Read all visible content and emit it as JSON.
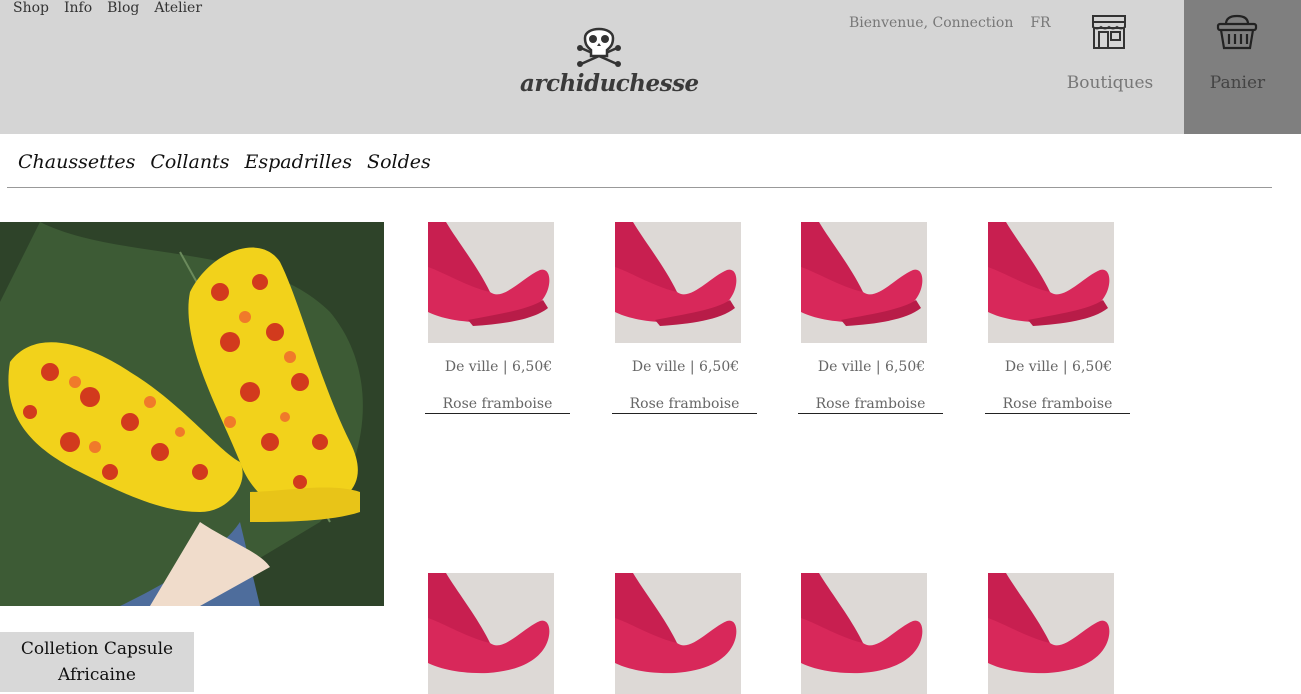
{
  "topnav": {
    "items": [
      "Shop",
      "Info",
      "Blog",
      "Atelier"
    ]
  },
  "logo": {
    "text": "archiduchesse"
  },
  "user": {
    "welcome": "Bienvenue, Connection",
    "lang": "FR"
  },
  "boutiques": {
    "label": "Boutiques"
  },
  "panier": {
    "label": "Panier"
  },
  "categories": [
    "Chaussettes",
    "Collants",
    "Espadrilles",
    "Soldes"
  ],
  "hero": {
    "caption_line1": "Colletion Capsule",
    "caption_line2": "Africaine"
  },
  "products": [
    {
      "price": "De ville | 6,50€",
      "color": "Rose framboise"
    },
    {
      "price": "De ville | 6,50€",
      "color": "Rose framboise"
    },
    {
      "price": "De ville | 6,50€",
      "color": "Rose framboise"
    },
    {
      "price": "De ville | 6,50€",
      "color": "Rose framboise"
    },
    {
      "price": "",
      "color": ""
    },
    {
      "price": "",
      "color": ""
    },
    {
      "price": "",
      "color": ""
    },
    {
      "price": "",
      "color": ""
    }
  ],
  "colors": {
    "header_bg": "#d5d5d5",
    "panier_bg": "#7f7f7f",
    "sock_pink": "#d8285a",
    "sock_yellow": "#f2d21b"
  }
}
